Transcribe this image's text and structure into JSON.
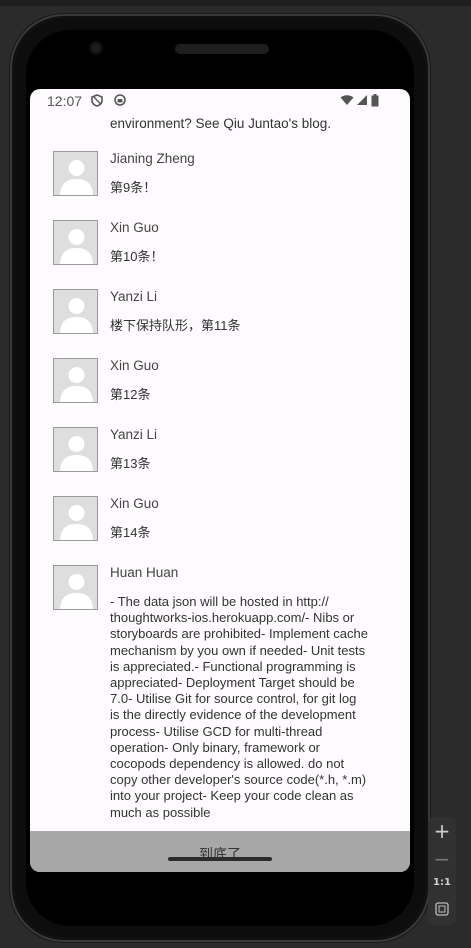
{
  "status_bar": {
    "time": "12:07",
    "icons": [
      "shield-icon",
      "android-icon",
      "wifi-icon",
      "signal-icon",
      "battery-icon"
    ]
  },
  "feed": {
    "partial_top_text": "environment? See Qiu Juntao's blog.",
    "items": [
      {
        "name": "Jianing Zheng",
        "text": "第9条！"
      },
      {
        "name": "Xin Guo",
        "text": "第10条！"
      },
      {
        "name": "Yanzi Li",
        "text": "楼下保持队形，第11条"
      },
      {
        "name": "Xin Guo",
        "text": "第12条"
      },
      {
        "name": "Yanzi Li",
        "text": "第13条"
      },
      {
        "name": "Xin Guo",
        "text": "第14条"
      },
      {
        "name": "Huan Huan",
        "text_lines": [
          "- The data json will be hosted in http://",
          "thoughtworks-ios.herokuapp.com/- Nibs or",
          "storyboards are prohibited- Implement cache",
          "mechanism by you own if needed- Unit tests",
          "is appreciated.- Functional programming is",
          "appreciated- Deployment Target should be",
          "7.0- Utilise Git for source control, for git log",
          "is the directly evidence of the development",
          "process- Utilise GCD for multi-thread",
          "operation- Only binary, framework or",
          "cocopods dependency is allowed. do not",
          "copy other developer's source code(*.h, *.m)",
          "into your project- Keep your code clean as",
          "much as possible"
        ]
      }
    ]
  },
  "footer": {
    "label": "到底了"
  },
  "emulator_controls": {
    "zoom_in": "+",
    "zoom_out": "−",
    "fit_label": "1:1",
    "frame_icon": "frame-icon"
  }
}
